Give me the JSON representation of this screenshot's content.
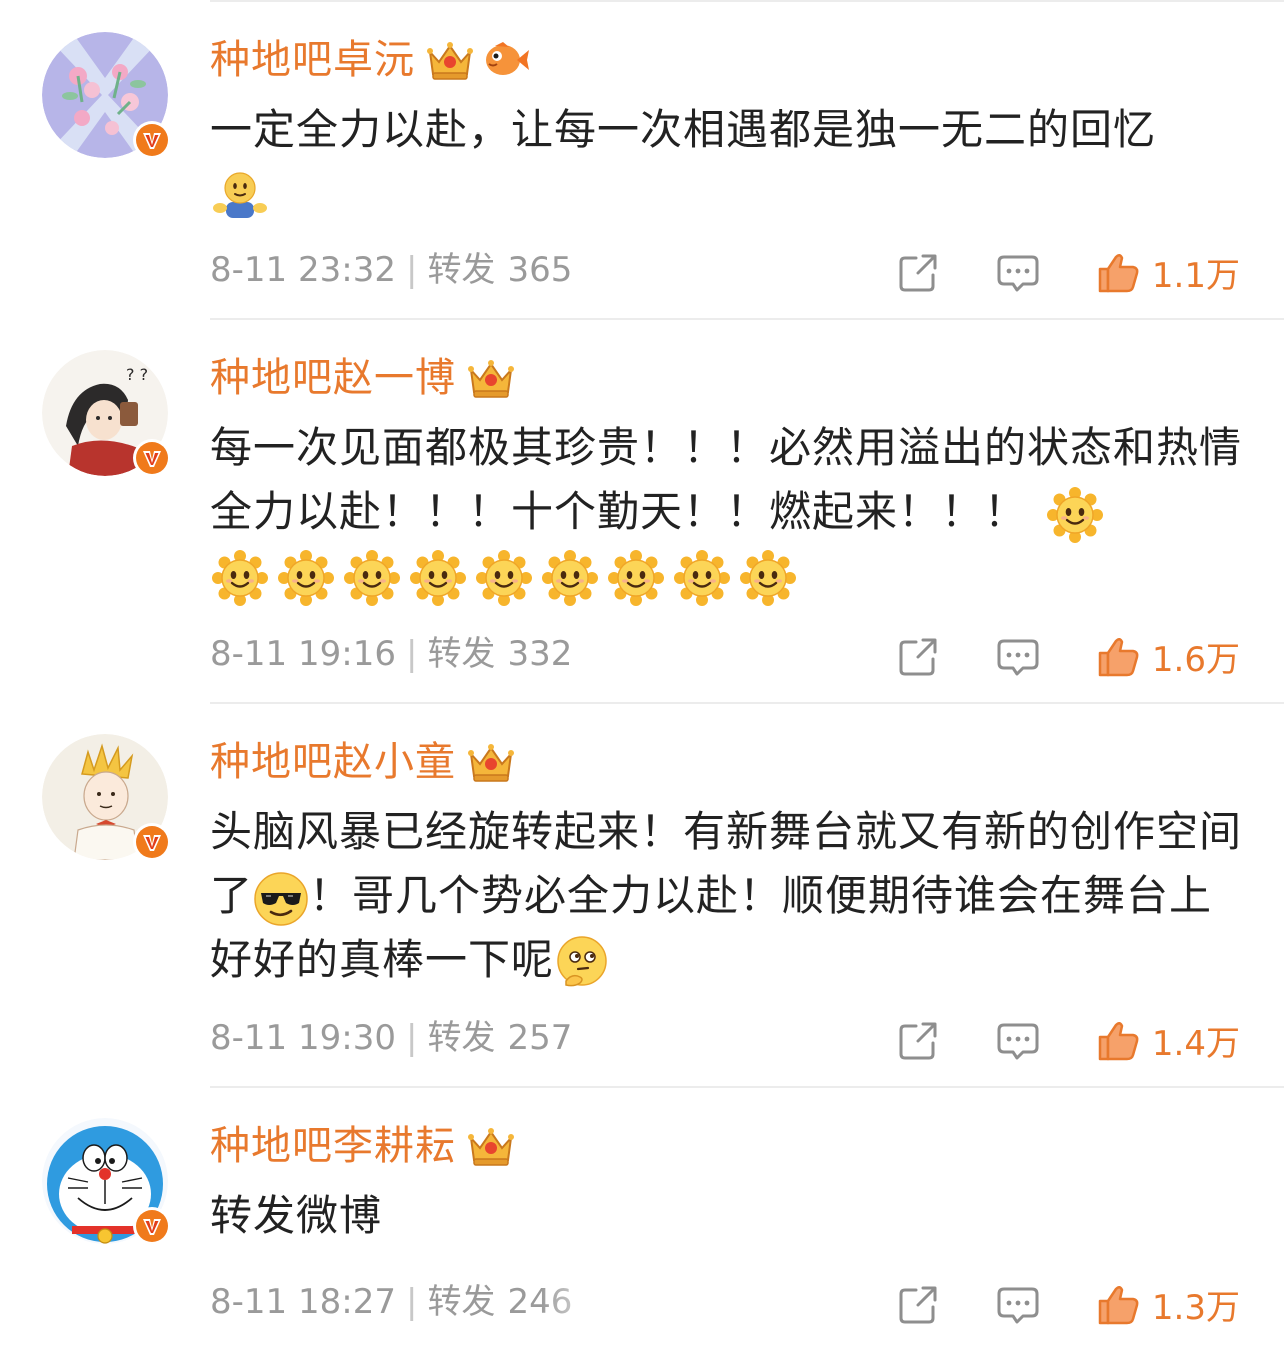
{
  "colors": {
    "accent": "#e8792d",
    "text": "#222222",
    "meta": "#9a9a9a",
    "divider": "#ececec",
    "verified_badge": "#f07a1b"
  },
  "repost_label": "转发",
  "comments": [
    {
      "username": "种地吧卓沅",
      "badges": [
        "crown-badge-icon",
        "fish-badge-icon"
      ],
      "avatar": "flower-x-avatar",
      "text": "一定全力以赴，让每一次相遇都是独一无二的回忆",
      "trailing_emojis": [
        "hug-emoji"
      ],
      "time": "8-11 23:32",
      "reposts": "365",
      "likes": "1.1万"
    },
    {
      "username": "种地吧赵一博",
      "badges": [
        "crown-badge-icon"
      ],
      "avatar": "cartoon-boy-avatar",
      "text": "每一次见面都极其珍贵！！！必然用溢出的状态和热情全力以赴！！！十个勤天！！燃起来！！！",
      "trailing_emojis": [
        "sun-emoji",
        "sun-emoji",
        "sun-emoji",
        "sun-emoji",
        "sun-emoji",
        "sun-emoji",
        "sun-emoji",
        "sun-emoji",
        "sun-emoji",
        "sun-emoji"
      ],
      "time": "8-11 19:16",
      "reposts": "332",
      "likes": "1.6万"
    },
    {
      "username": "种地吧赵小童",
      "badges": [
        "crown-badge-icon"
      ],
      "avatar": "little-prince-avatar",
      "text_part1": "头脑风暴已经旋转起来！有新舞台就又有新的创作空间了",
      "text_part2": "！哥几个势必全力以赴！顺便期待谁会在舞台上好好的真棒一下呢",
      "inline_emojis": [
        "sunglasses-emoji",
        "thinking-emoji"
      ],
      "time": "8-11 19:30",
      "reposts": "257",
      "likes": "1.4万"
    },
    {
      "username": "种地吧李耕耘",
      "badges": [
        "crown-badge-icon"
      ],
      "avatar": "doraemon-avatar",
      "text": "转发微博",
      "time": "8-11 18:27",
      "reposts": "246",
      "likes": "1.3万"
    }
  ]
}
